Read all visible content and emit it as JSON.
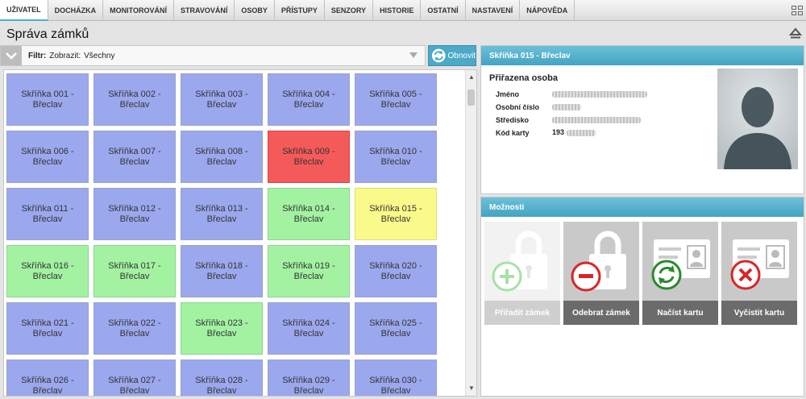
{
  "nav": {
    "tabs": [
      "UŽIVATEL",
      "DOCHÁZKA",
      "MONITOROVÁNÍ",
      "STRAVOVÁNÍ",
      "OSOBY",
      "PŘÍSTUPY",
      "SENZORY",
      "HISTORIE",
      "OSTATNÍ",
      "NASTAVENÍ",
      "NÁPOVĚDA"
    ],
    "active": "UŽIVATEL"
  },
  "page": {
    "title": "Správa zámků"
  },
  "filter": {
    "label": "Filtr:",
    "show_label": "Zobrazit:",
    "value": "Všechny"
  },
  "refresh_label": "Obnovit",
  "lockers": [
    {
      "l1": "Skříňka 001 -",
      "l2": "Břeclav",
      "status": "blue"
    },
    {
      "l1": "Skříňka 002 -",
      "l2": "Břeclav",
      "status": "blue"
    },
    {
      "l1": "Skříňka 003 -",
      "l2": "Břeclav",
      "status": "blue"
    },
    {
      "l1": "Skříňka 004 -",
      "l2": "Břeclav",
      "status": "blue"
    },
    {
      "l1": "Skříňka 005 -",
      "l2": "Břeclav",
      "status": "blue"
    },
    {
      "l1": "Skříňka 006 -",
      "l2": "Břeclav",
      "status": "blue"
    },
    {
      "l1": "Skříňka 007 -",
      "l2": "Břeclav",
      "status": "blue"
    },
    {
      "l1": "Skříňka 008 -",
      "l2": "Břeclav",
      "status": "blue"
    },
    {
      "l1": "Skříňka 009 -",
      "l2": "Břeclav",
      "status": "red"
    },
    {
      "l1": "Skříňka 010 -",
      "l2": "Břeclav",
      "status": "blue"
    },
    {
      "l1": "Skříňka 011 -",
      "l2": "Břeclav",
      "status": "blue"
    },
    {
      "l1": "Skříňka 012 -",
      "l2": "Břeclav",
      "status": "blue"
    },
    {
      "l1": "Skříňka 013 -",
      "l2": "Břeclav",
      "status": "blue"
    },
    {
      "l1": "Skříňka 014 -",
      "l2": "Břeclav",
      "status": "green"
    },
    {
      "l1": "Skříňka 015 -",
      "l2": "Břeclav",
      "status": "yellow"
    },
    {
      "l1": "Skříňka 016 -",
      "l2": "Břeclav",
      "status": "green"
    },
    {
      "l1": "Skříňka 017 -",
      "l2": "Břeclav",
      "status": "green"
    },
    {
      "l1": "Skříňka 018 -",
      "l2": "Břeclav",
      "status": "blue"
    },
    {
      "l1": "Skříňka 019 -",
      "l2": "Břeclav",
      "status": "green"
    },
    {
      "l1": "Skříňka 020 -",
      "l2": "Břeclav",
      "status": "blue"
    },
    {
      "l1": "Skříňka 021 -",
      "l2": "Břeclav",
      "status": "blue"
    },
    {
      "l1": "Skříňka 022 -",
      "l2": "Břeclav",
      "status": "blue"
    },
    {
      "l1": "Skříňka 023 -",
      "l2": "Břeclav",
      "status": "green"
    },
    {
      "l1": "Skříňka 024 -",
      "l2": "Břeclav",
      "status": "blue"
    },
    {
      "l1": "Skříňka 025 -",
      "l2": "Břeclav",
      "status": "blue"
    },
    {
      "l1": "Skříňka 026 -",
      "l2": "Břeclav",
      "status": "blue"
    },
    {
      "l1": "Skříňka 027 -",
      "l2": "Břeclav",
      "status": "blue"
    },
    {
      "l1": "Skříňka 028 -",
      "l2": "Břeclav",
      "status": "blue"
    },
    {
      "l1": "Skříňka 029 -",
      "l2": "Břeclav",
      "status": "blue"
    },
    {
      "l1": "Skříňka 030 -",
      "l2": "Břeclav",
      "status": "blue"
    }
  ],
  "detail": {
    "header": "Skříňka 015 - Břeclav",
    "assigned_title": "Přiřazena osoba",
    "fields": {
      "name_label": "Jméno",
      "personal_no_label": "Osobní číslo",
      "center_label": "Středisko",
      "card_label": "Kód karty",
      "card_prefix": "193"
    }
  },
  "options": {
    "header": "Možnosti",
    "buttons": [
      {
        "label": "Přiřadit zámek",
        "icon": "plus-lock-icon"
      },
      {
        "label": "Odebrat zámek",
        "icon": "minus-lock-icon"
      },
      {
        "label": "Načíst kartu",
        "icon": "refresh-card-icon"
      },
      {
        "label": "Vyčistit kartu",
        "icon": "delete-card-icon"
      }
    ]
  },
  "colors": {
    "accent": "#4da9c8",
    "locker_free": "#9ba8ee",
    "locker_alarm": "#f55a5a",
    "locker_assigned": "#a2f2a2",
    "locker_selected": "#fafa8a"
  }
}
